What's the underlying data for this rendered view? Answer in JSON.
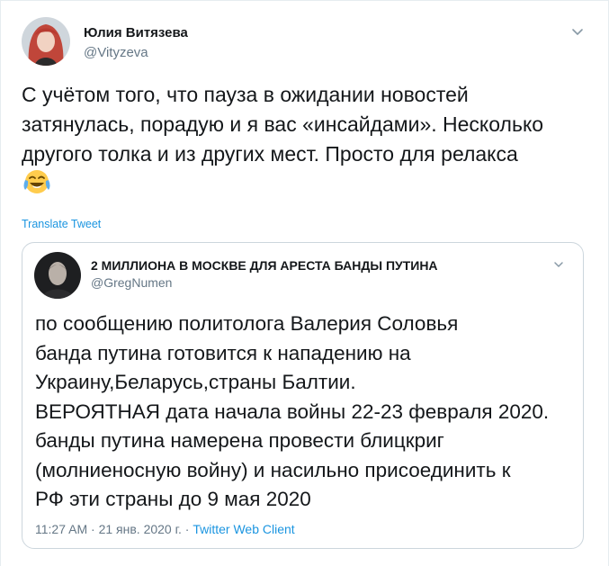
{
  "tweet": {
    "author_name": "Юлия Витязева",
    "author_handle": "@Vityzeva",
    "text": "С учётом того, что пауза в ожидании новостей\nзатянулась, порадую и я вас «инсайдами». Несколько\nдругого толка и из других мест. Просто для релакса",
    "emoji_icon": "face-with-tears-of-joy",
    "translate_label": "Translate Tweet"
  },
  "quote": {
    "author_name": "2 МИЛЛИОНА В МОСКВЕ ДЛЯ АРЕСТА БАНДЫ ПУТИНА",
    "author_handle": "@GregNumen",
    "text": "по сообщению политолога Валерия Соловья\nбанда путина готовится к нападению на\nУкраину,Беларусь,страны Балтии.\nВЕРОЯТНАЯ дата начала войны 22-23 февраля 2020.\nбанды путина намерена провести блицкриг\n(молниеносную войну) и насильно присоединить к\nРФ эти страны до 9 мая 2020",
    "time": "11:27 AM",
    "separator": "·",
    "date": "21 янв. 2020 г.",
    "client": "Twitter Web Client"
  },
  "colors": {
    "link": "#1b95e0",
    "secondary_text": "#657786",
    "border": "#ccd6dd"
  }
}
